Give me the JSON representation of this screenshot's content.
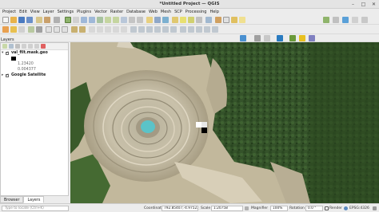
{
  "window": {
    "title": "*Untitled Project — QGIS",
    "min": "–",
    "max": "□",
    "close": "✕"
  },
  "menu": [
    "Project",
    "Edit",
    "View",
    "Layer",
    "Settings",
    "Plugins",
    "Vector",
    "Raster",
    "Database",
    "Web",
    "Mesh",
    "SCP",
    "Processing",
    "Help"
  ],
  "panel": {
    "title": "Layers",
    "layers": [
      {
        "name": "val_filt.mask.geo",
        "bold": true
      },
      {
        "name": "1.23420",
        "bold": false
      },
      {
        "name": "0.004377",
        "bold": false
      },
      {
        "name": "Google Satellite",
        "bold": true
      }
    ]
  },
  "tabs": [
    "Browser",
    "Layers"
  ],
  "status": {
    "locator_placeholder": "Type to locate (Ctrl+K)",
    "coordinate_label": "Coordinate",
    "coordinate_value": "792.85407,-4.97522",
    "scale_label": "Scale",
    "scale_value": "1:20758",
    "magnifier_label": "Magnifier",
    "magnifier_value": "100%",
    "rotation_label": "Rotation",
    "rotation_value": "0.0 °",
    "render_label": "Render",
    "crs_label": "EPSG:4326"
  },
  "colors": {
    "forest": "#2f4d23",
    "pit": "#c9c0a8",
    "water": "#5bc3c8"
  }
}
